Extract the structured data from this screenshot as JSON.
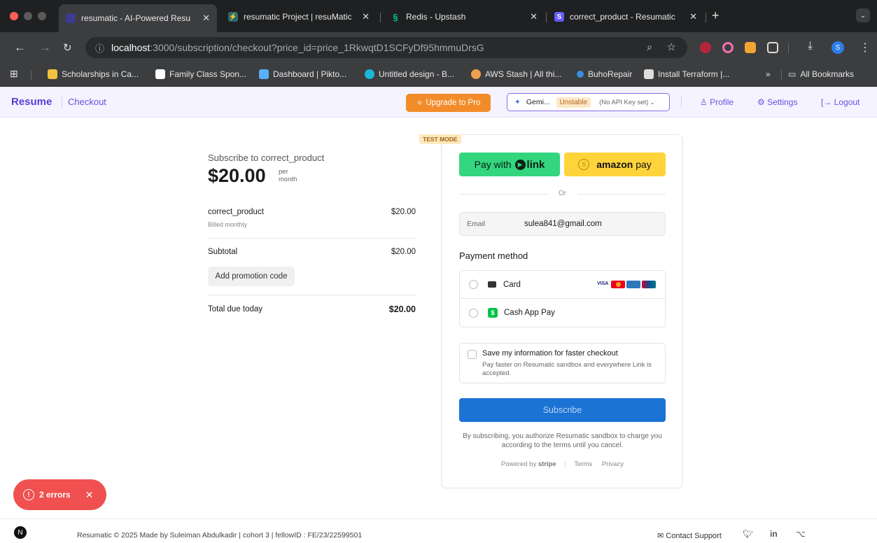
{
  "browser": {
    "tabs": [
      {
        "title": "resumatic - AI-Powered Resu",
        "active": true,
        "favicon_color": "#3b3b8f"
      },
      {
        "title": "resumatic Project | resuMatic",
        "active": false,
        "favicon_color": "#2a6b6b"
      },
      {
        "title": "Redis - Upstash",
        "active": false,
        "favicon_color": "#00c98d"
      },
      {
        "title": "correct_product - Resumatic",
        "active": false,
        "favicon_color": "#635bff"
      }
    ],
    "new_tab_icon": "+",
    "address": {
      "host": "localhost",
      "path": ":3000/subscription/checkout?price_id=price_1RkwqtD1SCFyDf95hmmuDrsG"
    },
    "bookmarks": [
      {
        "label": "Scholarships in Ca...",
        "color": "#f0c040"
      },
      {
        "label": "Family Class Spon...",
        "color": "#ffffff"
      },
      {
        "label": "Dashboard | Pikto...",
        "color": "#58b0ff"
      },
      {
        "label": "Untitled design - B...",
        "color": "#19b8d8"
      },
      {
        "label": "AWS Stash | All thi...",
        "color": "#f0a050"
      },
      {
        "label": "BuhoRepair",
        "color": "#3a8fe0"
      },
      {
        "label": "Install Terraform |...",
        "color": "#dddddd"
      }
    ],
    "all_bookmarks": "All Bookmarks",
    "more_bookmarks": "»"
  },
  "header": {
    "brand": "Resume",
    "crumb": "Checkout",
    "upgrade": "Upgrade to Pro",
    "model": "Gemi...",
    "model_badge": "Unstable",
    "api_key": "(No API Key set)",
    "profile": "Profile",
    "settings": "Settings",
    "logout": "Logout"
  },
  "summary": {
    "subscribe_to": "Subscribe to correct_product",
    "price": "$20.00",
    "per_1": "per",
    "per_2": "month",
    "product": "correct_product",
    "product_price": "$20.00",
    "billed": "Billed monthly",
    "subtotal_label": "Subtotal",
    "subtotal": "$20.00",
    "promo": "Add promotion code",
    "total_label": "Total due today",
    "total": "$20.00"
  },
  "payment": {
    "test_mode": "TEST MODE",
    "link_btn_prefix": "Pay with",
    "link_btn_brand": "link",
    "amazon_brand": "amazon",
    "amazon_suffix": "pay",
    "or": "Or",
    "email_label": "Email",
    "email_value": "sulea841@gmail.com",
    "method_title": "Payment method",
    "methods": [
      {
        "label": "Card"
      },
      {
        "label": "Cash App Pay"
      }
    ],
    "card_brands": [
      "VISA"
    ],
    "save_title": "Save my information for faster checkout",
    "save_desc": "Pay faster on Resumatic sandbox and everywhere Link is accepted.",
    "subscribe": "Subscribe",
    "legal": "By subscribing, you authorize Resumatic sandbox to charge you according to the terms until you cancel.",
    "powered_by": "Powered by",
    "stripe": "stripe",
    "terms": "Terms",
    "privacy": "Privacy"
  },
  "toast": {
    "label": "2 errors",
    "close": "✕"
  },
  "footer": {
    "credits": "Resumatic © 2025   Made by Suleiman Abdulkadir | cohort 3 | fellowID : FE/23/22599501",
    "contact": "Contact Support",
    "logo": "N"
  },
  "colors": {
    "accent": "#6b4fe0",
    "upgrade": "#f28c2a",
    "subscribe": "#1b73d4",
    "link_green": "#33d67f",
    "amazon_yellow": "#ffd43b",
    "error": "#f05050"
  }
}
